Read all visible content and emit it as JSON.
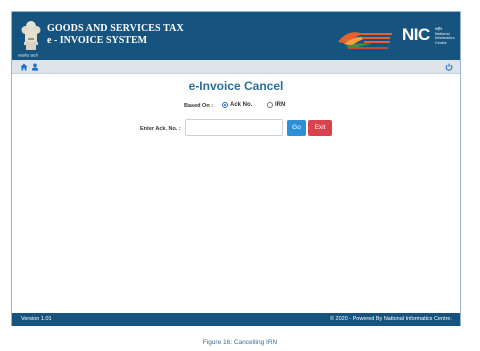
{
  "header": {
    "title_line1": "GOODS AND SERVICES TAX",
    "title_line2": "e - INVOICE SYSTEM",
    "emblem_caption": "सत्यमेव जयते",
    "nic_logo_text": "NIC",
    "nic_subtext": [
      "राष्ट्रीय",
      "National",
      "Informatics",
      "Centre"
    ]
  },
  "navbar": {
    "home_icon": "home-icon",
    "user_icon": "user-icon",
    "power_icon": "power-icon"
  },
  "main": {
    "title": "e-Invoice Cancel",
    "based_on_label": "Based On :",
    "options": [
      {
        "label": "Ack No.",
        "checked": true
      },
      {
        "label": "IRN",
        "checked": false
      }
    ],
    "ack_label": "Enter Ack. No. :",
    "ack_value": "",
    "ack_placeholder": "",
    "go_label": "Go",
    "exit_label": "Exit"
  },
  "footer": {
    "version": "Version 1.01",
    "copyright": "© 2020 - Powered By National Informatics Centre."
  },
  "caption": "Figure 16: Cancelling IRN",
  "colors": {
    "header_bg": "#16547f",
    "title_color": "#2c6e9b",
    "go_button": "#2d8fd8",
    "exit_button": "#d9434e"
  }
}
